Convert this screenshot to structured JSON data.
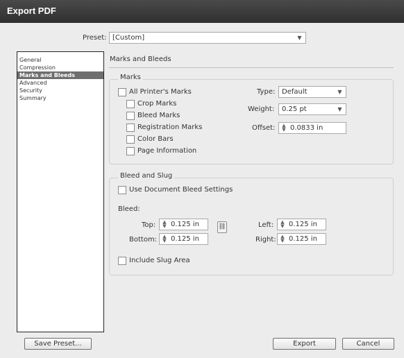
{
  "window": {
    "title": "Export PDF"
  },
  "preset": {
    "label": "Preset:",
    "value": "[Custom]"
  },
  "sidebar": {
    "items": [
      {
        "label": "General",
        "selected": false
      },
      {
        "label": "Compression",
        "selected": false
      },
      {
        "label": "Marks and Bleeds",
        "selected": true
      },
      {
        "label": "Advanced",
        "selected": false
      },
      {
        "label": "Security",
        "selected": false
      },
      {
        "label": "Summary",
        "selected": false
      }
    ]
  },
  "section_title": "Marks and Bleeds",
  "marks": {
    "group_title": "Marks",
    "all_printers_marks": "All Printer's Marks",
    "crop_marks": "Crop Marks",
    "bleed_marks": "Bleed Marks",
    "registration_marks": "Registration Marks",
    "color_bars": "Color Bars",
    "page_information": "Page Information",
    "type_label": "Type:",
    "type_value": "Default",
    "weight_label": "Weight:",
    "weight_value": "0.25 pt",
    "offset_label": "Offset:",
    "offset_value": "0.0833 in"
  },
  "bleed": {
    "group_title": "Bleed and Slug",
    "use_doc_bleed": "Use Document Bleed Settings",
    "bleed_label": "Bleed:",
    "top_label": "Top:",
    "top_value": "0.125 in",
    "bottom_label": "Bottom:",
    "bottom_value": "0.125 in",
    "left_label": "Left:",
    "left_value": "0.125 in",
    "right_label": "Right:",
    "right_value": "0.125 in",
    "include_slug": "Include Slug Area"
  },
  "buttons": {
    "save_preset": "Save Preset...",
    "export": "Export",
    "cancel": "Cancel"
  }
}
